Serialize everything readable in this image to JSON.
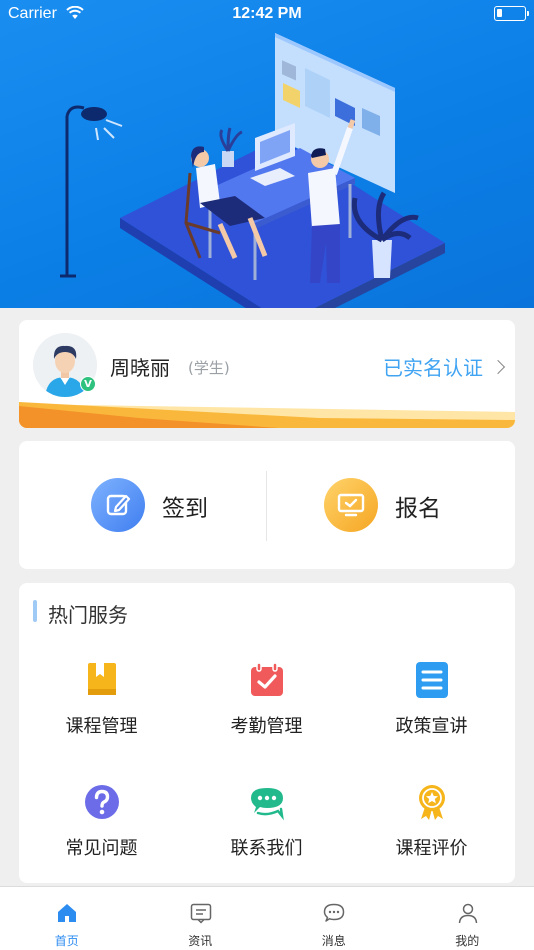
{
  "status_bar": {
    "carrier": "Carrier",
    "time": "12:42 PM"
  },
  "profile": {
    "name": "周晓丽",
    "role": "(学生)",
    "verification": "已实名认证",
    "badge": "V"
  },
  "actions": [
    {
      "label": "签到",
      "icon": "edit-icon"
    },
    {
      "label": "报名",
      "icon": "monitor-check-icon"
    }
  ],
  "services": {
    "title": "热门服务",
    "items": [
      {
        "label": "课程管理",
        "icon": "book-icon",
        "color": "#f5b51b"
      },
      {
        "label": "考勤管理",
        "icon": "calendar-check-icon",
        "color": "#f05a5a"
      },
      {
        "label": "政策宣讲",
        "icon": "document-list-icon",
        "color": "#2e9cf0"
      },
      {
        "label": "常见问题",
        "icon": "question-icon",
        "color": "#6c6ce8"
      },
      {
        "label": "联系我们",
        "icon": "chat-icon",
        "color": "#22b98c"
      },
      {
        "label": "课程评价",
        "icon": "award-icon",
        "color": "#f5b51b"
      }
    ]
  },
  "tabbar": {
    "active_index": 0,
    "items": [
      {
        "label": "首页",
        "icon": "home-icon"
      },
      {
        "label": "资讯",
        "icon": "news-icon"
      },
      {
        "label": "消息",
        "icon": "message-icon"
      },
      {
        "label": "我的",
        "icon": "user-icon"
      }
    ]
  },
  "colors": {
    "hero": "#0f86ec",
    "accent": "#2d8cf0",
    "verify": "#41a4f2"
  }
}
